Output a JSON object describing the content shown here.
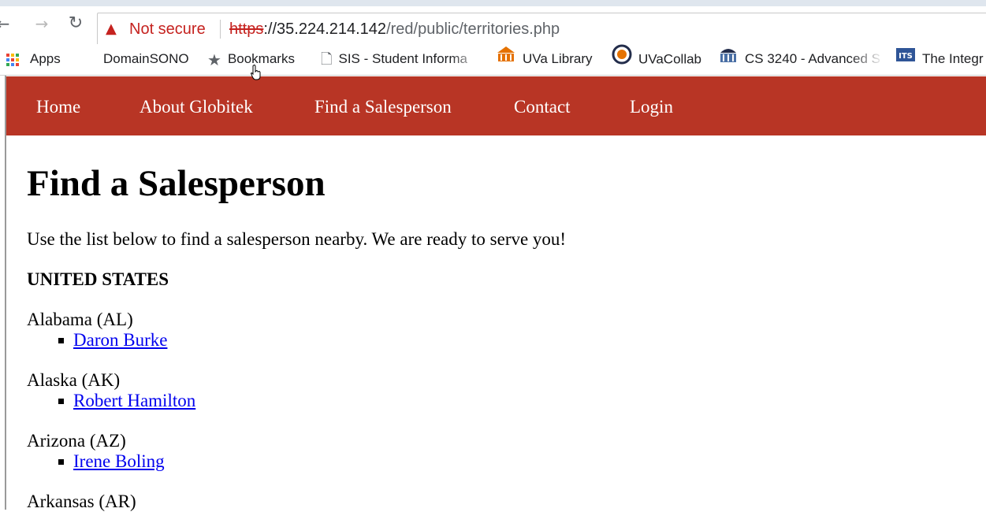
{
  "browser": {
    "security_label": "Not secure",
    "url_scheme": "https",
    "url_rest_host": "://35.224.214.142",
    "url_path": "/red/public/territories.php",
    "bookmarks": [
      {
        "label": "Apps",
        "icon": "apps-grid-icon"
      },
      {
        "label": "DomainSONO",
        "icon": ""
      },
      {
        "label": "Bookmarks",
        "icon": "star-icon"
      },
      {
        "label": "SIS - Student Informa",
        "icon": "page-icon"
      },
      {
        "label": "UVa Library",
        "icon": "uva-library-icon"
      },
      {
        "label": "UVaCollab",
        "icon": "uvacollab-icon"
      },
      {
        "label": "CS 3240 - Advanced S",
        "icon": "rotunda-icon"
      },
      {
        "label": "The Integr",
        "icon": "its-icon"
      }
    ]
  },
  "site_nav": {
    "items": [
      "Home",
      "About Globitek",
      "Find a Salesperson",
      "Contact",
      "Login"
    ],
    "bg_color": "#b83525"
  },
  "main": {
    "title": "Find a Salesperson",
    "intro": "Use the list below to find a salesperson nearby. We are ready to serve you!",
    "country": "UNITED STATES",
    "states": [
      {
        "name": "Alabama (AL)",
        "reps": [
          "Daron Burke"
        ]
      },
      {
        "name": "Alaska (AK)",
        "reps": [
          "Robert Hamilton"
        ]
      },
      {
        "name": "Arizona (AZ)",
        "reps": [
          "Irene Boling"
        ]
      },
      {
        "name": "Arkansas (AR)",
        "reps": []
      }
    ]
  }
}
